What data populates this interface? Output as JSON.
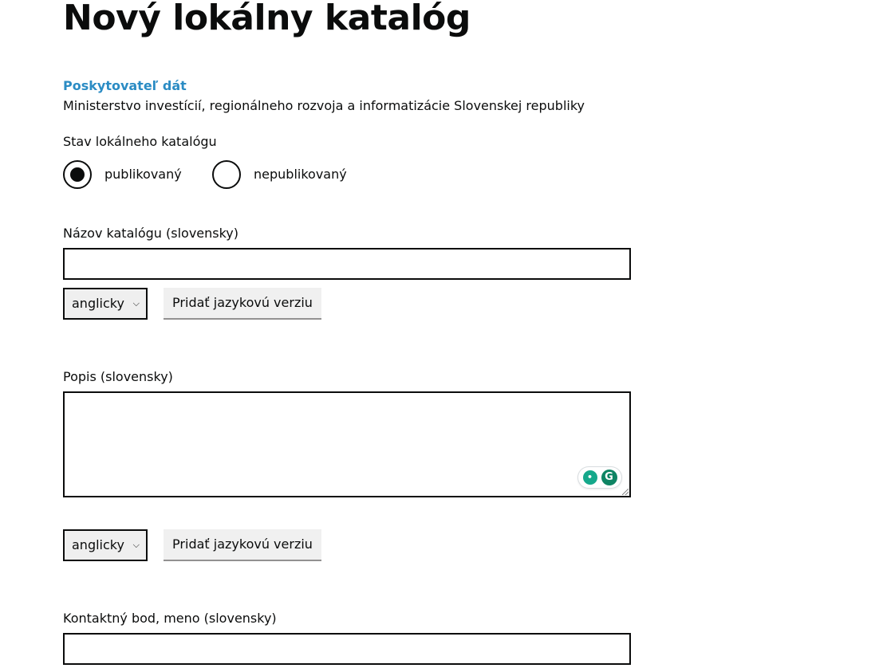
{
  "page": {
    "title": "Nový lokálny katalóg"
  },
  "provider": {
    "label": "Poskytovateľ dát",
    "value": "Ministerstvo investícií, regionálneho rozvoja a informatizácie Slovenskej republiky"
  },
  "status": {
    "label": "Stav lokálneho katalógu",
    "options": [
      {
        "label": "publikovaný",
        "checked": true
      },
      {
        "label": "nepublikovaný",
        "checked": false
      }
    ]
  },
  "name_field": {
    "label": "Názov katalógu (slovensky)",
    "value": "",
    "language_select": "anglicky",
    "add_button": "Pridať jazykovú verziu"
  },
  "description_field": {
    "label": "Popis (slovensky)",
    "value": "",
    "language_select": "anglicky",
    "add_button": "Pridať jazykovú verziu"
  },
  "contact_field": {
    "label": "Kontaktný bod, meno (slovensky)",
    "value": ""
  },
  "icons": {
    "grammarly_bulb": "lightbulb-icon",
    "grammarly_logo": "grammarly-icon",
    "select_chevron": "chevron-down-icon"
  },
  "colors": {
    "accent": "#2b8cc4",
    "text": "#0b0c0c",
    "button_bg": "#f0f0f0",
    "grammarly": "#15a88b"
  }
}
